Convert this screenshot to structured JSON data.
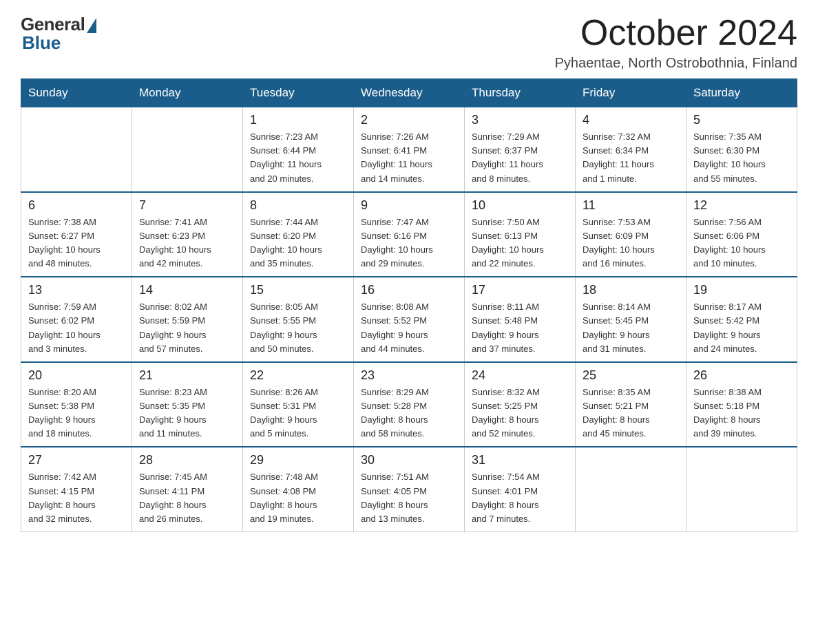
{
  "logo": {
    "general": "General",
    "blue": "Blue"
  },
  "title": "October 2024",
  "location": "Pyhaentae, North Ostrobothnia, Finland",
  "days_of_week": [
    "Sunday",
    "Monday",
    "Tuesday",
    "Wednesday",
    "Thursday",
    "Friday",
    "Saturday"
  ],
  "weeks": [
    [
      {
        "day": "",
        "info": ""
      },
      {
        "day": "",
        "info": ""
      },
      {
        "day": "1",
        "info": "Sunrise: 7:23 AM\nSunset: 6:44 PM\nDaylight: 11 hours\nand 20 minutes."
      },
      {
        "day": "2",
        "info": "Sunrise: 7:26 AM\nSunset: 6:41 PM\nDaylight: 11 hours\nand 14 minutes."
      },
      {
        "day": "3",
        "info": "Sunrise: 7:29 AM\nSunset: 6:37 PM\nDaylight: 11 hours\nand 8 minutes."
      },
      {
        "day": "4",
        "info": "Sunrise: 7:32 AM\nSunset: 6:34 PM\nDaylight: 11 hours\nand 1 minute."
      },
      {
        "day": "5",
        "info": "Sunrise: 7:35 AM\nSunset: 6:30 PM\nDaylight: 10 hours\nand 55 minutes."
      }
    ],
    [
      {
        "day": "6",
        "info": "Sunrise: 7:38 AM\nSunset: 6:27 PM\nDaylight: 10 hours\nand 48 minutes."
      },
      {
        "day": "7",
        "info": "Sunrise: 7:41 AM\nSunset: 6:23 PM\nDaylight: 10 hours\nand 42 minutes."
      },
      {
        "day": "8",
        "info": "Sunrise: 7:44 AM\nSunset: 6:20 PM\nDaylight: 10 hours\nand 35 minutes."
      },
      {
        "day": "9",
        "info": "Sunrise: 7:47 AM\nSunset: 6:16 PM\nDaylight: 10 hours\nand 29 minutes."
      },
      {
        "day": "10",
        "info": "Sunrise: 7:50 AM\nSunset: 6:13 PM\nDaylight: 10 hours\nand 22 minutes."
      },
      {
        "day": "11",
        "info": "Sunrise: 7:53 AM\nSunset: 6:09 PM\nDaylight: 10 hours\nand 16 minutes."
      },
      {
        "day": "12",
        "info": "Sunrise: 7:56 AM\nSunset: 6:06 PM\nDaylight: 10 hours\nand 10 minutes."
      }
    ],
    [
      {
        "day": "13",
        "info": "Sunrise: 7:59 AM\nSunset: 6:02 PM\nDaylight: 10 hours\nand 3 minutes."
      },
      {
        "day": "14",
        "info": "Sunrise: 8:02 AM\nSunset: 5:59 PM\nDaylight: 9 hours\nand 57 minutes."
      },
      {
        "day": "15",
        "info": "Sunrise: 8:05 AM\nSunset: 5:55 PM\nDaylight: 9 hours\nand 50 minutes."
      },
      {
        "day": "16",
        "info": "Sunrise: 8:08 AM\nSunset: 5:52 PM\nDaylight: 9 hours\nand 44 minutes."
      },
      {
        "day": "17",
        "info": "Sunrise: 8:11 AM\nSunset: 5:48 PM\nDaylight: 9 hours\nand 37 minutes."
      },
      {
        "day": "18",
        "info": "Sunrise: 8:14 AM\nSunset: 5:45 PM\nDaylight: 9 hours\nand 31 minutes."
      },
      {
        "day": "19",
        "info": "Sunrise: 8:17 AM\nSunset: 5:42 PM\nDaylight: 9 hours\nand 24 minutes."
      }
    ],
    [
      {
        "day": "20",
        "info": "Sunrise: 8:20 AM\nSunset: 5:38 PM\nDaylight: 9 hours\nand 18 minutes."
      },
      {
        "day": "21",
        "info": "Sunrise: 8:23 AM\nSunset: 5:35 PM\nDaylight: 9 hours\nand 11 minutes."
      },
      {
        "day": "22",
        "info": "Sunrise: 8:26 AM\nSunset: 5:31 PM\nDaylight: 9 hours\nand 5 minutes."
      },
      {
        "day": "23",
        "info": "Sunrise: 8:29 AM\nSunset: 5:28 PM\nDaylight: 8 hours\nand 58 minutes."
      },
      {
        "day": "24",
        "info": "Sunrise: 8:32 AM\nSunset: 5:25 PM\nDaylight: 8 hours\nand 52 minutes."
      },
      {
        "day": "25",
        "info": "Sunrise: 8:35 AM\nSunset: 5:21 PM\nDaylight: 8 hours\nand 45 minutes."
      },
      {
        "day": "26",
        "info": "Sunrise: 8:38 AM\nSunset: 5:18 PM\nDaylight: 8 hours\nand 39 minutes."
      }
    ],
    [
      {
        "day": "27",
        "info": "Sunrise: 7:42 AM\nSunset: 4:15 PM\nDaylight: 8 hours\nand 32 minutes."
      },
      {
        "day": "28",
        "info": "Sunrise: 7:45 AM\nSunset: 4:11 PM\nDaylight: 8 hours\nand 26 minutes."
      },
      {
        "day": "29",
        "info": "Sunrise: 7:48 AM\nSunset: 4:08 PM\nDaylight: 8 hours\nand 19 minutes."
      },
      {
        "day": "30",
        "info": "Sunrise: 7:51 AM\nSunset: 4:05 PM\nDaylight: 8 hours\nand 13 minutes."
      },
      {
        "day": "31",
        "info": "Sunrise: 7:54 AM\nSunset: 4:01 PM\nDaylight: 8 hours\nand 7 minutes."
      },
      {
        "day": "",
        "info": ""
      },
      {
        "day": "",
        "info": ""
      }
    ]
  ]
}
